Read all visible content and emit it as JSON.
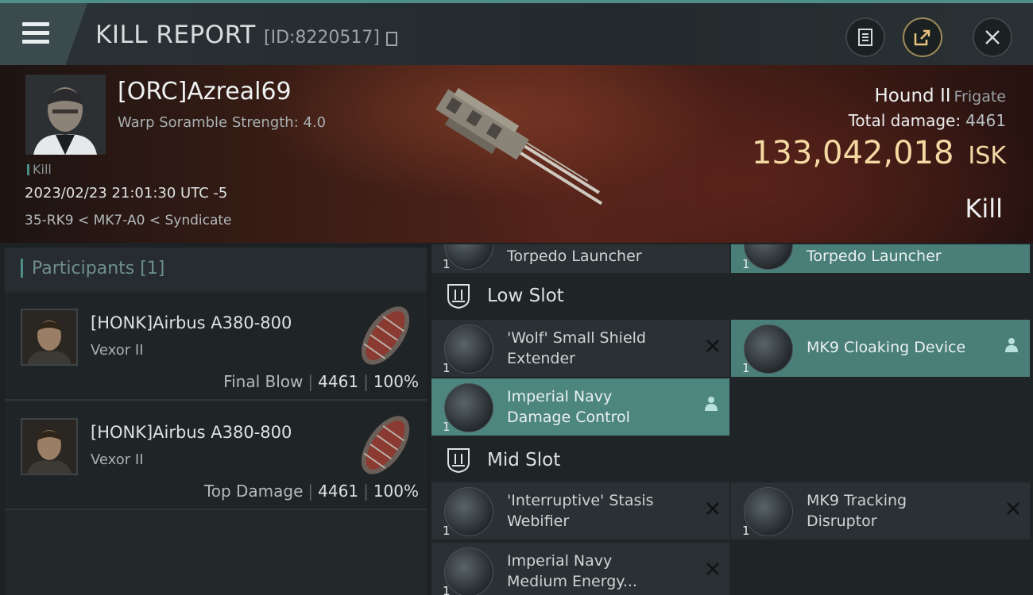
{
  "header": {
    "title": "KILL REPORT",
    "report_id": "[ID:8220517]"
  },
  "victim": {
    "name": "[ORC]Azreal69",
    "scramble": "Warp Soramble Strength: 4.0",
    "kill_tag": "Kill",
    "datetime": "2023/02/23 21:01:30 UTC -5",
    "location": "35-RK9 < MK7-A0 < Syndicate"
  },
  "ship": {
    "name": "Hound II",
    "class": "Frigate",
    "damage_label": "Total damage:",
    "damage": "4461",
    "isk_value": "133,042,018",
    "isk_unit": "ISK",
    "kill_type": "Kill"
  },
  "participants": {
    "title": "Participants [1]",
    "rows": [
      {
        "name": "[HONK]Airbus A380-800",
        "ship": "Vexor II",
        "role": "Final Blow",
        "damage": "4461",
        "percent": "100%"
      },
      {
        "name": "[HONK]Airbus A380-800",
        "ship": "Vexor II",
        "role": "Top Damage",
        "damage": "4461",
        "percent": "100%"
      }
    ]
  },
  "modules": {
    "top_row": [
      {
        "qty": "1",
        "name": "Torpedo Launcher",
        "state": "destroyed"
      },
      {
        "qty": "1",
        "name": "Torpedo Launcher",
        "state": "dropped"
      }
    ],
    "low_slot": {
      "label": "Low Slot",
      "items": [
        {
          "qty": "1",
          "name_line1": "'Wolf' Small Shield",
          "name_line2": "Extender",
          "state": "destroyed"
        },
        {
          "qty": "1",
          "name_line1": "MK9 Cloaking Device",
          "name_line2": "",
          "state": "dropped"
        },
        {
          "qty": "1",
          "name_line1": "Imperial Navy",
          "name_line2": "Damage Control",
          "state": "dropped"
        }
      ]
    },
    "mid_slot": {
      "label": "Mid Slot",
      "items": [
        {
          "qty": "1",
          "name_line1": "'Interruptive' Stasis",
          "name_line2": "Webifier",
          "state": "destroyed"
        },
        {
          "qty": "1",
          "name_line1": "MK9 Tracking",
          "name_line2": "Disruptor",
          "state": "destroyed"
        },
        {
          "qty": "1",
          "name_line1": "Imperial Navy",
          "name_line2": "Medium Energy...",
          "state": "destroyed"
        }
      ]
    }
  },
  "icons": {
    "menu": "hamburger-menu-icon",
    "copy": "copy-icon",
    "clipboard": "clipboard-icon",
    "share": "share-icon",
    "close": "close-icon"
  },
  "colors": {
    "accent": "#4d8f88",
    "isk": "#f5d9a3",
    "dropped_bg": "#4a7e78",
    "destroyed_bg": "#2a3033"
  }
}
